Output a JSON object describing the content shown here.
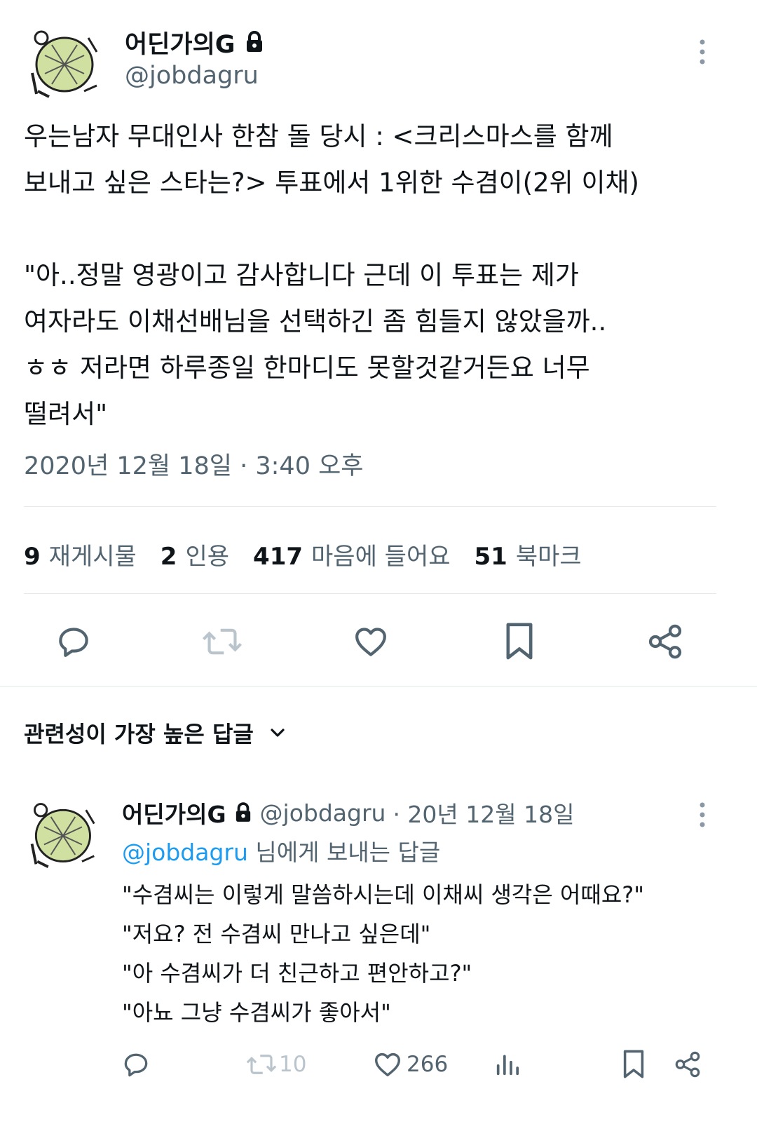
{
  "tweet": {
    "author_name": "어딘가의G",
    "author_handle": "@jobdagru",
    "body": "우는남자 무대인사 한참 돌 당시 : <크리스마스를 함께\n보내고 싶은 스타는?> 투표에서 1위한 수겸이(2위 이채)\n\n\"아..정말 영광이고 감사합니다 근데 이 투표는 제가\n여자라도 이채선배님을 선택하긴 좀 힘들지 않았을까..\nㅎㅎ 저라면 하루종일 한마디도 못할것같거든요 너무\n떨려서\"",
    "timestamp": "2020년 12월 18일 · 3:40 오후",
    "stats": [
      {
        "count": "9",
        "label": "재게시물"
      },
      {
        "count": "2",
        "label": "인용"
      },
      {
        "count": "417",
        "label": "마음에 들어요"
      },
      {
        "count": "51",
        "label": "북마크"
      }
    ],
    "actions": [
      "reply-icon",
      "repost-icon",
      "like-icon",
      "bookmark-icon",
      "share-icon"
    ]
  },
  "replies_header": {
    "sort_label": "관련성이 가장 높은 답글"
  },
  "reply": {
    "author_name": "어딘가의G",
    "author_handle": "@jobdagru",
    "date": "· 20년 12월 18일",
    "replying_to_handle": "@jobdagru",
    "replying_to_suffix": " 님에게 보내는 답글",
    "body": "\"수겸씨는 이렇게 말씀하시는데 이채씨 생각은 어때요?\"\n\"저요? 전 수겸씨 만나고 싶은데\"\n\"아 수겸씨가 더 친근하고 편안하고?\"\n\"아뇨 그냥 수겸씨가 좋아서\"",
    "repost_count": "10",
    "like_count": "266"
  },
  "colors": {
    "text": "#0f1419",
    "secondary": "#536471",
    "link": "#1d9bf0",
    "avatar_green": "#cfe0a0"
  }
}
